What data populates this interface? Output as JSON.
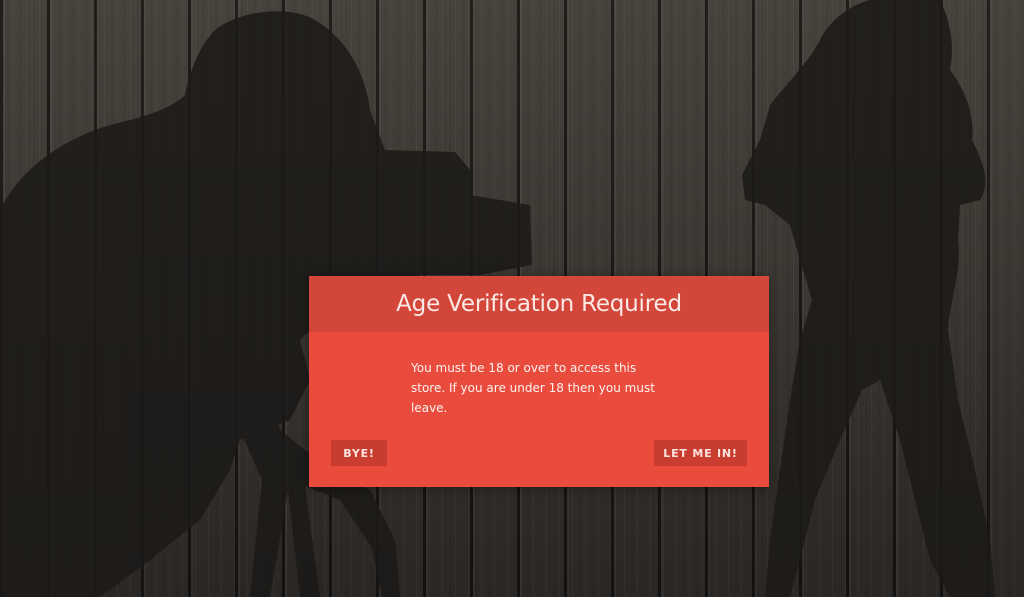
{
  "colors": {
    "modal_background": "#e94b3c",
    "modal_header": "#d3473a",
    "button_background": "#c93d30",
    "wood_background": "#3a3632"
  },
  "background": {
    "icons": [
      "wood-plank-background",
      "photographer-silhouette",
      "camera-tripod-silhouette",
      "woman-silhouette"
    ]
  },
  "modal": {
    "title": "Age Verification Required",
    "message": "You must be 18 or over to access this store. If you are under 18 then you must leave.",
    "decline_label": "BYE!",
    "accept_label": "LET ME IN!"
  }
}
